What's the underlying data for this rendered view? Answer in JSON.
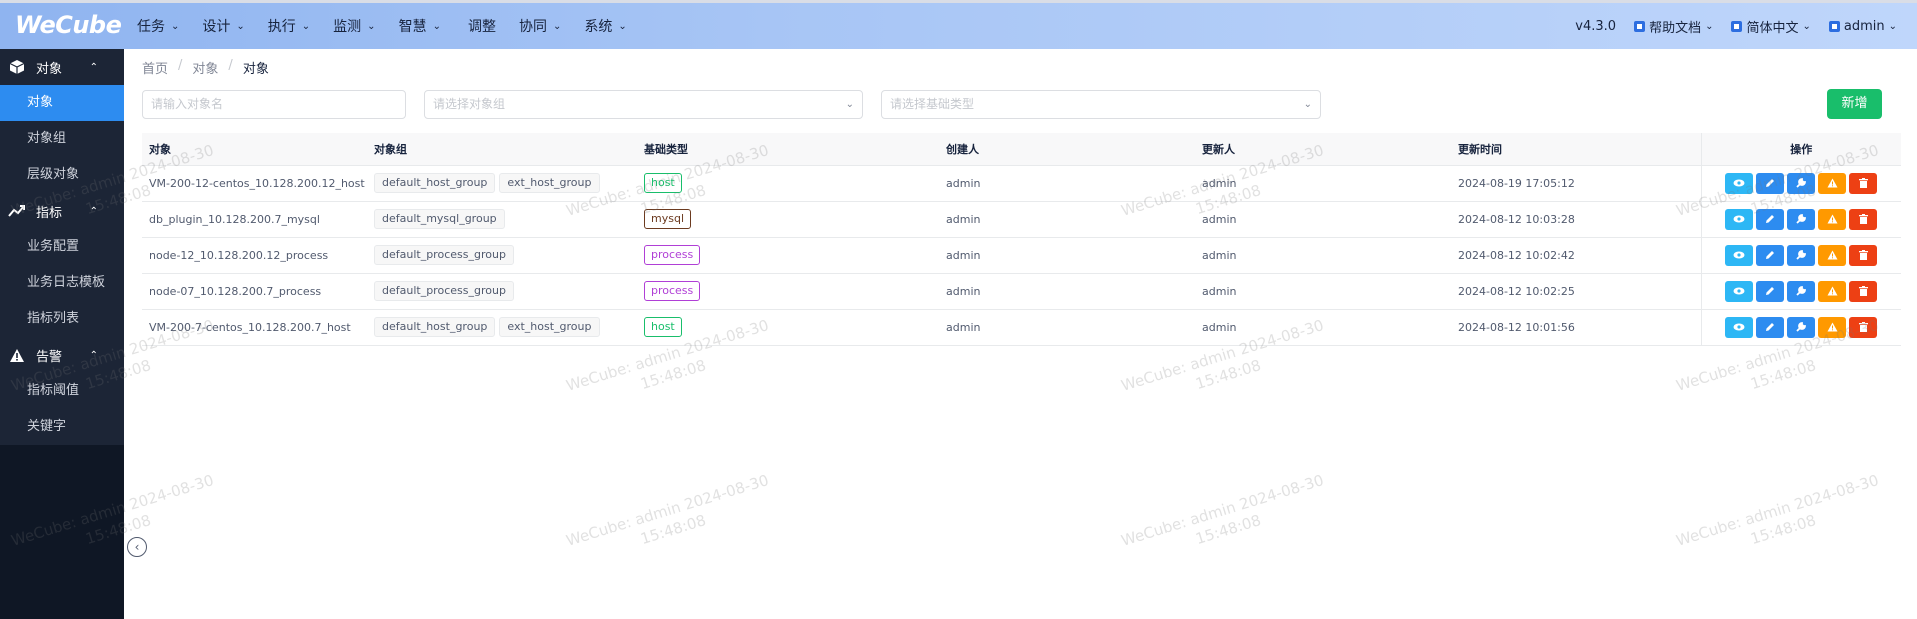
{
  "header": {
    "logo": "WeCube",
    "nav": [
      {
        "label": "任务",
        "has_dropdown": true
      },
      {
        "label": "设计",
        "has_dropdown": true
      },
      {
        "label": "执行",
        "has_dropdown": true
      },
      {
        "label": "监测",
        "has_dropdown": true
      },
      {
        "label": "智慧",
        "has_dropdown": true
      },
      {
        "label": "调整",
        "has_dropdown": false
      },
      {
        "label": "协同",
        "has_dropdown": true
      },
      {
        "label": "系统",
        "has_dropdown": true
      }
    ],
    "version": "v4.3.0",
    "help": "帮助文档",
    "language": "简体中文",
    "user": "admin"
  },
  "sidebar": {
    "groups": [
      {
        "label": "对象",
        "icon": "cube-icon",
        "items": [
          "对象",
          "对象组",
          "层级对象"
        ]
      },
      {
        "label": "指标",
        "icon": "trend-icon",
        "items": [
          "业务配置",
          "业务日志模板",
          "指标列表"
        ]
      },
      {
        "label": "告警",
        "icon": "warning-icon",
        "items": [
          "指标阈值",
          "关键字"
        ]
      }
    ],
    "active_item": "对象"
  },
  "breadcrumb": [
    "首页",
    "对象",
    "对象"
  ],
  "filters": {
    "name_placeholder": "请输入对象名",
    "group_placeholder": "请选择对象组",
    "type_placeholder": "请选择基础类型"
  },
  "new_button": "新增",
  "table": {
    "columns": [
      "对象",
      "对象组",
      "基础类型",
      "创建人",
      "更新人",
      "更新时间",
      "操作"
    ],
    "rows": [
      {
        "name": "VM-200-12-centos_10.128.200.12_host",
        "groups": [
          "default_host_group",
          "ext_host_group"
        ],
        "type": "host",
        "creator": "admin",
        "updater": "admin",
        "updated": "2024-08-19 17:05:12"
      },
      {
        "name": "db_plugin_10.128.200.7_mysql",
        "groups": [
          "default_mysql_group"
        ],
        "type": "mysql",
        "creator": "admin",
        "updater": "admin",
        "updated": "2024-08-12 10:03:28"
      },
      {
        "name": "node-12_10.128.200.12_process",
        "groups": [
          "default_process_group"
        ],
        "type": "process",
        "creator": "admin",
        "updater": "admin",
        "updated": "2024-08-12 10:02:42"
      },
      {
        "name": "node-07_10.128.200.7_process",
        "groups": [
          "default_process_group"
        ],
        "type": "process",
        "creator": "admin",
        "updater": "admin",
        "updated": "2024-08-12 10:02:25"
      },
      {
        "name": "VM-200-7-centos_10.128.200.7_host",
        "groups": [
          "default_host_group",
          "ext_host_group"
        ],
        "type": "host",
        "creator": "admin",
        "updater": "admin",
        "updated": "2024-08-12 10:01:56"
      }
    ],
    "type_colors": {
      "host": "#19be6b",
      "mysql": "#6b3a1f",
      "process": "#b03fd6"
    },
    "actions": [
      {
        "name": "view-button",
        "icon": "eye-icon",
        "color": "#2db7f5"
      },
      {
        "name": "edit-button",
        "icon": "pencil-icon",
        "color": "#2d8cf0"
      },
      {
        "name": "config-button",
        "icon": "wrench-icon",
        "color": "#2d8cf0"
      },
      {
        "name": "alarm-button",
        "icon": "warning-icon",
        "color": "#ff9900"
      },
      {
        "name": "delete-button",
        "icon": "trash-icon",
        "color": "#ed4014"
      }
    ]
  },
  "watermark": {
    "line1": "WeCube: admin 2024-08-30",
    "line2": "15:48:08"
  }
}
